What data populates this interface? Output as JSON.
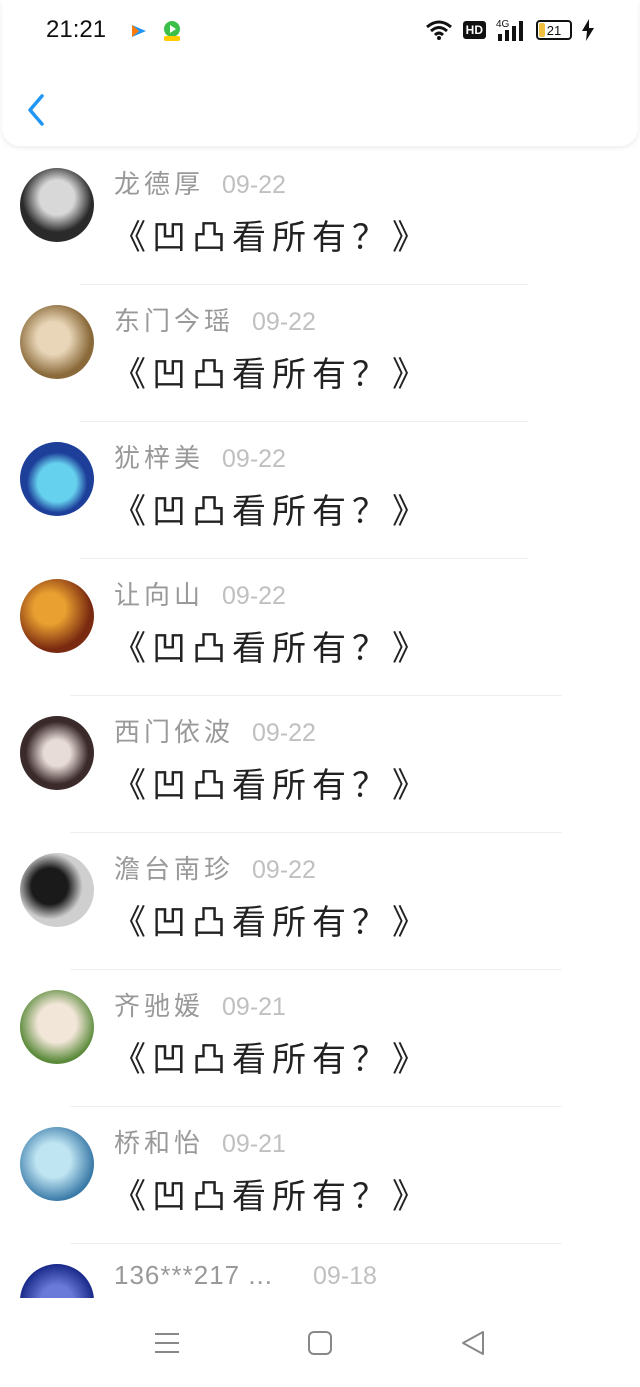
{
  "status_bar": {
    "time": "21:21",
    "network": "4G",
    "hd": "HD",
    "battery": "21"
  },
  "header": {
    "back_icon": "chevron-left-icon",
    "accent": "#2196f3"
  },
  "list": [
    {
      "name": "龙德厚",
      "date": "09-22",
      "message": "《凹凸看所有？》",
      "avatar_colors": [
        "#2a2a2a",
        "#d8d8d8"
      ]
    },
    {
      "name": "东门今瑶",
      "date": "09-22",
      "message": "《凹凸看所有？》",
      "avatar_colors": [
        "#8a6a3a",
        "#e9d6b8"
      ]
    },
    {
      "name": "犹梓美",
      "date": "09-22",
      "message": "《凹凸看所有？》",
      "avatar_colors": [
        "#1d3f9a",
        "#66d1ee"
      ]
    },
    {
      "name": "让向山",
      "date": "09-22",
      "message": "《凹凸看所有？》",
      "avatar_colors": [
        "#7a2a10",
        "#e9a030"
      ]
    },
    {
      "name": "西门依波",
      "date": "09-22",
      "message": "《凹凸看所有？》",
      "avatar_colors": [
        "#3a2a2a",
        "#e8dcd8"
      ]
    },
    {
      "name": "澹台南珍",
      "date": "09-22",
      "message": "《凹凸看所有？》",
      "avatar_colors": [
        "#1a1a1a",
        "#cfcfcf"
      ]
    },
    {
      "name": "齐驰媛",
      "date": "09-21",
      "message": "《凹凸看所有？》",
      "avatar_colors": [
        "#5a8a3a",
        "#f2e6d8"
      ]
    },
    {
      "name": "桥和怡",
      "date": "09-21",
      "message": "《凹凸看所有？》",
      "avatar_colors": [
        "#3a7aa8",
        "#bfe4f2"
      ]
    },
    {
      "name": "136***217 ...",
      "date": "09-18",
      "message": "",
      "avatar_colors": [
        "#1a2a8a",
        "#6a7ad8"
      ]
    }
  ],
  "nav": {
    "menu_icon": "menu-icon",
    "home_icon": "home-square-icon",
    "back_icon": "back-triangle-icon"
  }
}
